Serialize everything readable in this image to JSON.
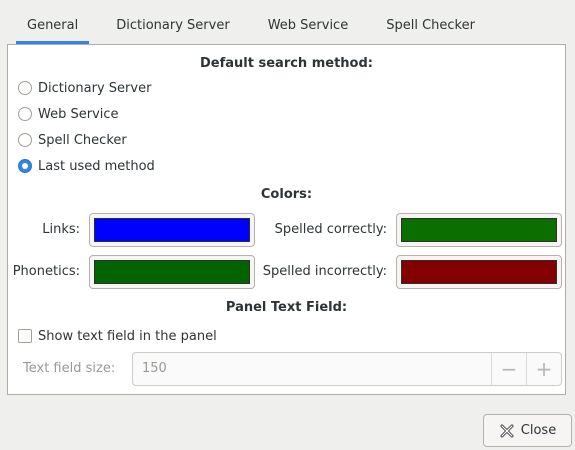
{
  "tabs": [
    "General",
    "Dictionary Server",
    "Web Service",
    "Spell Checker"
  ],
  "search": {
    "heading": "Default search method:",
    "options": [
      "Dictionary Server",
      "Web Service",
      "Spell Checker",
      "Last used method"
    ],
    "selected": "Last used method"
  },
  "colors": {
    "heading": "Colors:",
    "links_label": "Links:",
    "links_color": "#0000ff",
    "phonetics_label": "Phonetics:",
    "phonetics_color": "#006400",
    "correct_label": "Spelled correctly:",
    "correct_color": "#0b6f00",
    "incorrect_label": "Spelled incorrectly:",
    "incorrect_color": "#820000"
  },
  "panel": {
    "heading": "Panel Text Field:",
    "show_label": "Show text field in the panel",
    "show_checked": false,
    "size_label": "Text field size:",
    "size_value": "150",
    "minus": "−",
    "plus": "+"
  },
  "footer": {
    "close_label": "Close"
  }
}
